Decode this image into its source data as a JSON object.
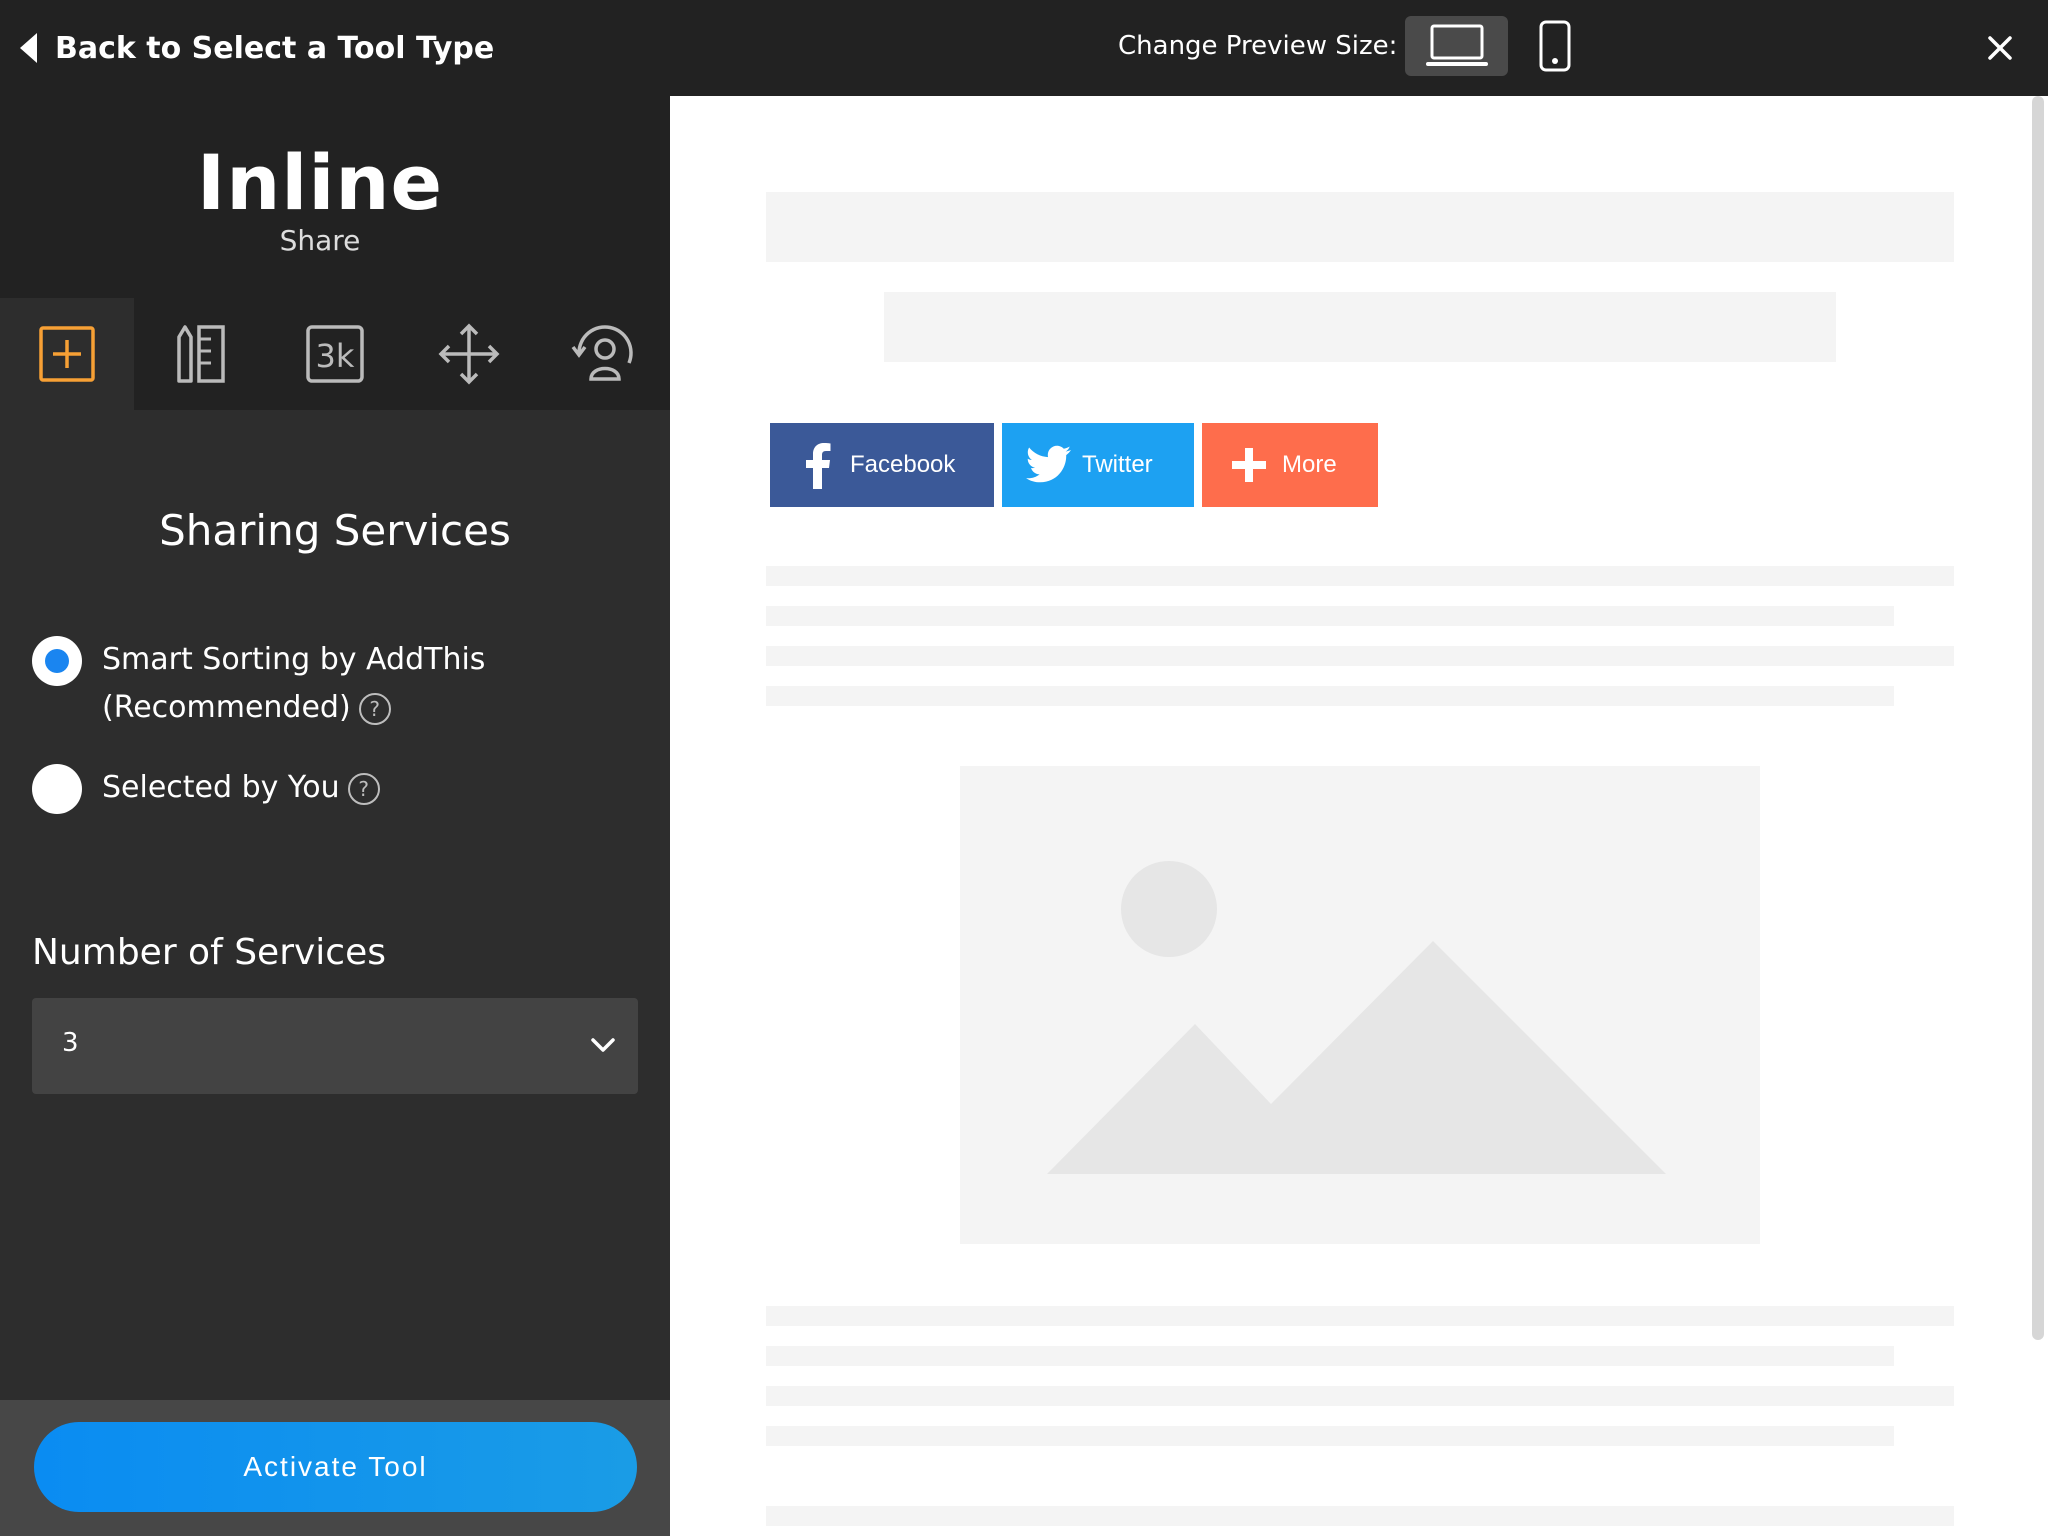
{
  "topbar": {
    "back_label": "Back to Select a Tool Type",
    "preview_size_label": "Change Preview Size:"
  },
  "tool": {
    "title": "Inline",
    "subtitle": "Share"
  },
  "sidebar": {
    "tabs": [
      {
        "name": "services",
        "icon": "add-box-icon",
        "active": true
      },
      {
        "name": "design",
        "icon": "ruler-pencil-icon",
        "active": false
      },
      {
        "name": "counts",
        "icon": "counter-3k-icon",
        "active": false
      },
      {
        "name": "position",
        "icon": "move-arrows-icon",
        "active": false
      },
      {
        "name": "targeting",
        "icon": "user-target-icon",
        "active": false
      }
    ],
    "section_title": "Sharing Services",
    "radio_options": [
      {
        "label": "Smart Sorting by AddThis (Recommended)",
        "checked": true
      },
      {
        "label": "Selected by You",
        "checked": false
      }
    ],
    "help_glyph": "?",
    "number_label": "Number of Services",
    "number_value": "3",
    "activate_label": "Activate Tool"
  },
  "preview": {
    "share_buttons": [
      {
        "label": "Facebook",
        "icon": "facebook-icon",
        "color": "#3b5998"
      },
      {
        "label": "Twitter",
        "icon": "twitter-icon",
        "color": "#1da1f2"
      },
      {
        "label": "More",
        "icon": "plus-icon",
        "color": "#fe6d4c"
      }
    ]
  },
  "colors": {
    "accent_orange": "#f7a035",
    "accent_blue": "#0a8cf2",
    "dark_bg": "#222222",
    "panel_bg": "#2d2d2d"
  }
}
